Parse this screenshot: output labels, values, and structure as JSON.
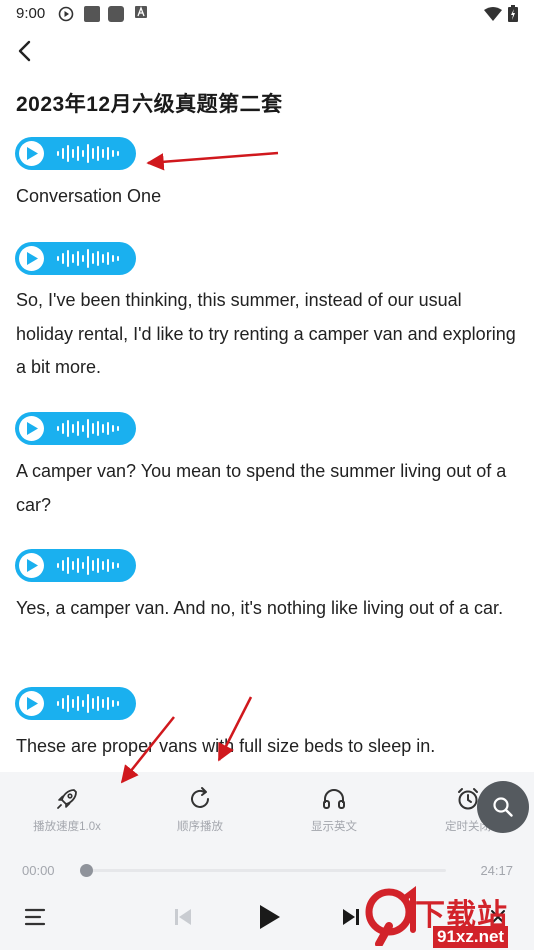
{
  "status_bar": {
    "time": "9:00"
  },
  "header": {
    "title": "2023年12月六级真题第二套"
  },
  "transcript": [
    {
      "text": "Conversation One"
    },
    {
      "text": "So, I've been thinking, this summer, instead of our usual holiday rental, I'd like to try renting a camper van and exploring a bit more."
    },
    {
      "text": "A camper van? You mean to spend the summer living out of a car?"
    },
    {
      "text": "Yes, a camper van. And no, it's nothing like living out of a car."
    },
    {
      "text": "These are proper vans with full size beds to sleep in."
    }
  ],
  "player": {
    "controls": [
      {
        "label": "播放速度1.0x",
        "icon": "rocket-icon"
      },
      {
        "label": "顺序播放",
        "icon": "repeat-icon"
      },
      {
        "label": "显示英文",
        "icon": "headphones-icon"
      },
      {
        "label": "定时关闭",
        "icon": "alarm-clock-icon"
      }
    ],
    "current_time": "00:00",
    "total_time": "24:17",
    "progress": 0
  },
  "watermark": {
    "text": "下载站",
    "url": "91xz.net"
  },
  "colors": {
    "accent": "#1ab0ef",
    "annotation": "#d0181d",
    "player_bg": "#f4f5f7"
  }
}
